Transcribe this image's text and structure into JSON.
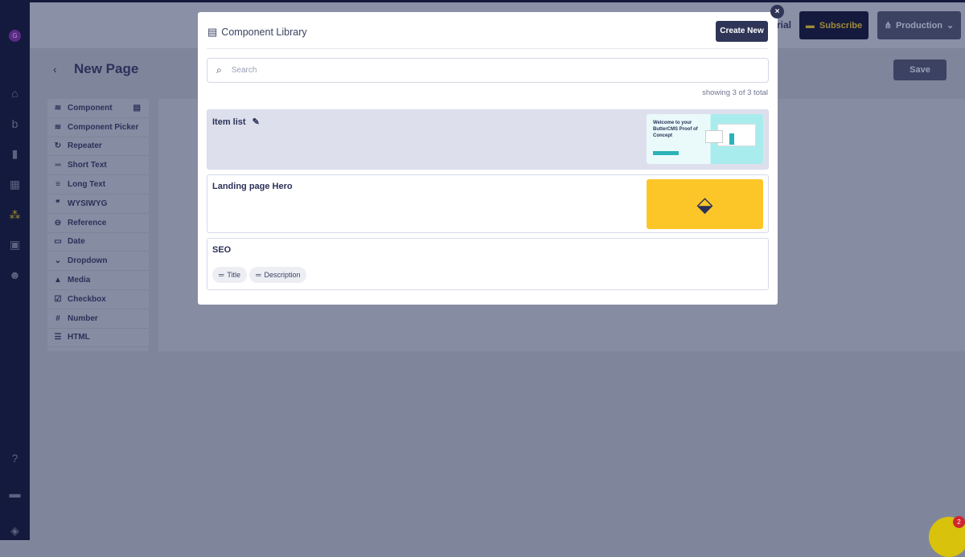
{
  "sidebar": {
    "avatar": "G",
    "icons": [
      "home-icon",
      "blog-icon",
      "page-icon",
      "collection-icon",
      "components-icon",
      "media-icon",
      "users-icon",
      "help-icon",
      "book-icon",
      "layers-icon"
    ]
  },
  "header": {
    "trial_partial": "rial",
    "subscribe": "Subscribe",
    "environment": "Production"
  },
  "page": {
    "title": "New Page",
    "save": "Save"
  },
  "fields": [
    {
      "label": "Component",
      "icon": "layers"
    },
    {
      "label": "Component Picker",
      "icon": "layers-plus"
    },
    {
      "label": "Repeater",
      "icon": "repeat"
    },
    {
      "label": "Short Text",
      "icon": "short-text"
    },
    {
      "label": "Long Text",
      "icon": "long-text"
    },
    {
      "label": "WYSIWYG",
      "icon": "quote"
    },
    {
      "label": "Reference",
      "icon": "link"
    },
    {
      "label": "Date",
      "icon": "calendar"
    },
    {
      "label": "Dropdown",
      "icon": "chevron-down"
    },
    {
      "label": "Media",
      "icon": "image"
    },
    {
      "label": "Checkbox",
      "icon": "checkbox"
    },
    {
      "label": "Number",
      "icon": "hash"
    },
    {
      "label": "HTML",
      "icon": "list"
    }
  ],
  "modal": {
    "title": "Component Library",
    "create": "Create New",
    "search_placeholder": "Search",
    "search_value": "",
    "count": "showing 3 of 3 total",
    "items": [
      {
        "name": "Item list",
        "thumb_text": "Welcome to your ButterCMS Proof of Concept"
      },
      {
        "name": "Landing page Hero"
      },
      {
        "name": "SEO",
        "chips": [
          "Title",
          "Description"
        ]
      }
    ]
  },
  "chat": {
    "badge": "2"
  },
  "colors": {
    "sidebar": "#141a3d",
    "accent": "#2f3556",
    "hero_yellow": "#fcc629"
  }
}
